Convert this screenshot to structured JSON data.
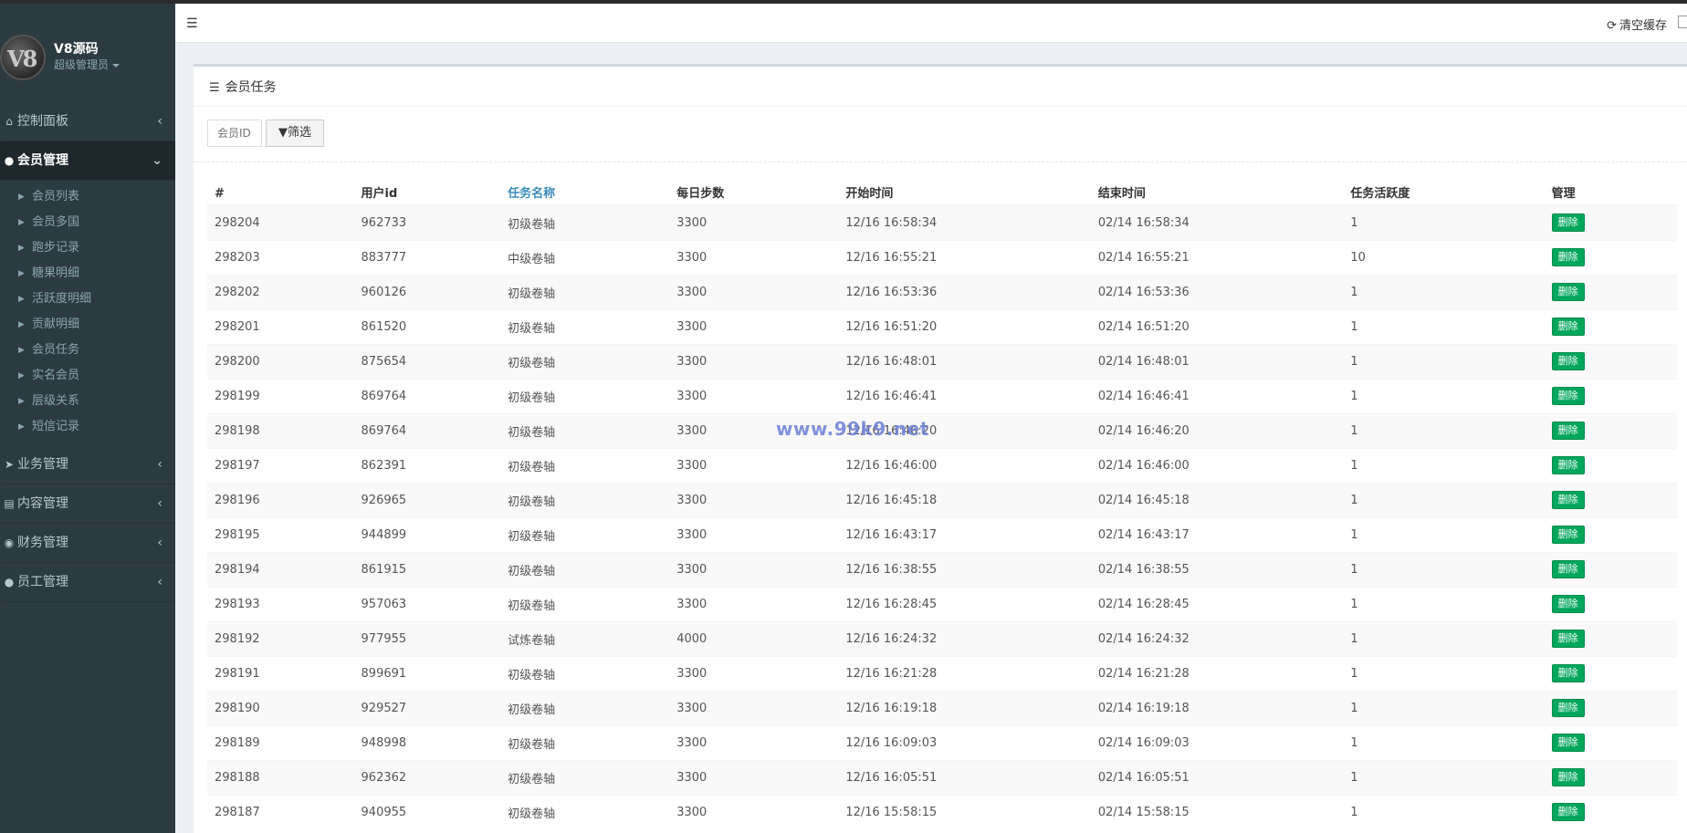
{
  "sidebar": {
    "brand_logo": "V8",
    "user_name": "V8源码",
    "user_role": "超级管理员",
    "menu": [
      {
        "label": "控制面板",
        "icon": "home-icon",
        "active": false
      },
      {
        "label": "会员管理",
        "icon": "user-icon",
        "active": true
      },
      {
        "label": "业务管理",
        "icon": "rocket-icon",
        "active": false
      },
      {
        "label": "内容管理",
        "icon": "book-icon",
        "active": false
      },
      {
        "label": "财务管理",
        "icon": "money-icon",
        "active": false
      },
      {
        "label": "员工管理",
        "icon": "users-icon",
        "active": false
      }
    ],
    "submenu": [
      "会员列表",
      "会员多国",
      "跑步记录",
      "糖果明细",
      "活跃度明细",
      "贡献明细",
      "会员任务",
      "实名会员",
      "层级关系",
      "短信记录"
    ]
  },
  "topbar": {
    "toggle_icon": "menu-toggle-icon",
    "clear_cache": "清空缓存"
  },
  "box": {
    "title": "会员任务",
    "filter_placeholder": "会员ID",
    "filter_button": "筛选"
  },
  "table": {
    "headers": [
      "#",
      "用户id",
      "任务名称",
      "每日步数",
      "开始时间",
      "结束时间",
      "任务活跃度",
      "管理"
    ],
    "delete_label": "删除",
    "rows": [
      [
        "298204",
        "962733",
        "初级卷轴",
        "3300",
        "12/16 16:58:34",
        "02/14 16:58:34",
        "1"
      ],
      [
        "298203",
        "883777",
        "中级卷轴",
        "3300",
        "12/16 16:55:21",
        "02/14 16:55:21",
        "10"
      ],
      [
        "298202",
        "960126",
        "初级卷轴",
        "3300",
        "12/16 16:53:36",
        "02/14 16:53:36",
        "1"
      ],
      [
        "298201",
        "861520",
        "初级卷轴",
        "3300",
        "12/16 16:51:20",
        "02/14 16:51:20",
        "1"
      ],
      [
        "298200",
        "875654",
        "初级卷轴",
        "3300",
        "12/16 16:48:01",
        "02/14 16:48:01",
        "1"
      ],
      [
        "298199",
        "869764",
        "初级卷轴",
        "3300",
        "12/16 16:46:41",
        "02/14 16:46:41",
        "1"
      ],
      [
        "298198",
        "869764",
        "初级卷轴",
        "3300",
        "12/16 16:46:20",
        "02/14 16:46:20",
        "1"
      ],
      [
        "298197",
        "862391",
        "初级卷轴",
        "3300",
        "12/16 16:46:00",
        "02/14 16:46:00",
        "1"
      ],
      [
        "298196",
        "926965",
        "初级卷轴",
        "3300",
        "12/16 16:45:18",
        "02/14 16:45:18",
        "1"
      ],
      [
        "298195",
        "944899",
        "初级卷轴",
        "3300",
        "12/16 16:43:17",
        "02/14 16:43:17",
        "1"
      ],
      [
        "298194",
        "861915",
        "初级卷轴",
        "3300",
        "12/16 16:38:55",
        "02/14 16:38:55",
        "1"
      ],
      [
        "298193",
        "957063",
        "初级卷轴",
        "3300",
        "12/16 16:28:45",
        "02/14 16:28:45",
        "1"
      ],
      [
        "298192",
        "977955",
        "试炼卷轴",
        "4000",
        "12/16 16:24:32",
        "02/14 16:24:32",
        "1"
      ],
      [
        "298191",
        "899691",
        "初级卷轴",
        "3300",
        "12/16 16:21:28",
        "02/14 16:21:28",
        "1"
      ],
      [
        "298190",
        "929527",
        "初级卷轴",
        "3300",
        "12/16 16:19:18",
        "02/14 16:19:18",
        "1"
      ],
      [
        "298189",
        "948998",
        "初级卷轴",
        "3300",
        "12/16 16:09:03",
        "02/14 16:09:03",
        "1"
      ],
      [
        "298188",
        "962362",
        "初级卷轴",
        "3300",
        "12/16 16:05:51",
        "02/14 16:05:51",
        "1"
      ],
      [
        "298187",
        "940955",
        "初级卷轴",
        "3300",
        "12/16 15:58:15",
        "02/14 15:58:15",
        "1"
      ]
    ]
  },
  "watermark": "www.99k9.net",
  "colors": {
    "sidebar_bg": "#2c3b41",
    "sidebar_active_bg": "#1e282c",
    "delete_button": "#00a65a",
    "link_header": "#3c8dbc"
  }
}
